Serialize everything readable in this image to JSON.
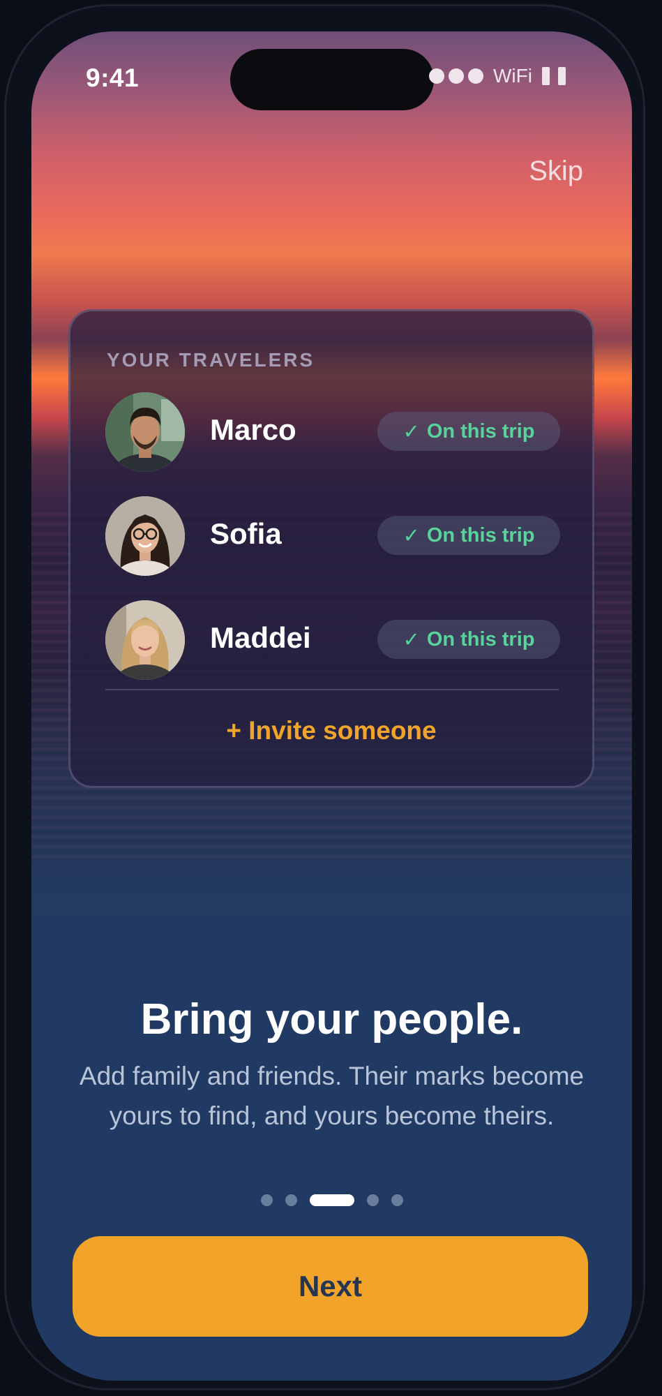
{
  "status_bar": {
    "time": "9:41",
    "wifi_label": "WiFi"
  },
  "skip_label": "Skip",
  "travelers_card": {
    "title": "YOUR TRAVELERS",
    "travelers": [
      {
        "name": "Marco",
        "status": "On this trip"
      },
      {
        "name": "Sofia",
        "status": "On this trip"
      },
      {
        "name": "Maddei",
        "status": "On this trip"
      }
    ],
    "invite_label": "+ Invite someone"
  },
  "onboarding": {
    "headline": "Bring your people.",
    "body": "Add family and friends. Their marks become yours to find, and yours become theirs.",
    "page_count": 5,
    "active_page": 3
  },
  "next_label": "Next",
  "colors": {
    "accent": "#f1a32a",
    "status_green": "#58d39a",
    "background_bottom": "#213a63"
  },
  "icons": {
    "check": "check-icon"
  }
}
